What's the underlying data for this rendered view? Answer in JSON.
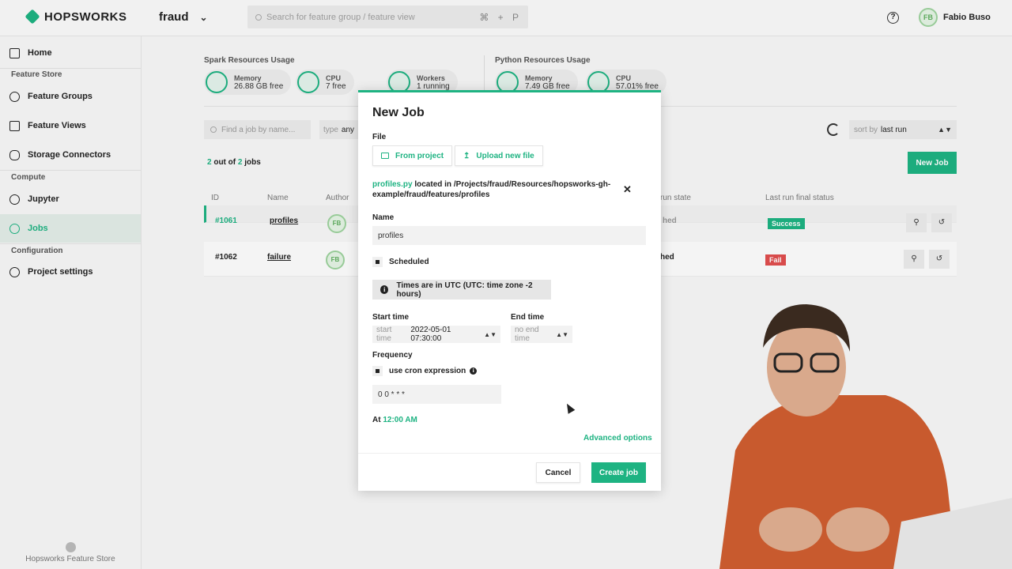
{
  "app": {
    "brand": "HOPSWORKS",
    "project": "fraud",
    "user": "Fabio Buso",
    "user_initials": "FB",
    "accent": "#1eb382"
  },
  "search": {
    "placeholder": "Search for feature group / feature view",
    "shortcut": "⌘ + P"
  },
  "sidebar": {
    "home": "Home",
    "feature_store_section": "Feature Store",
    "feature_groups": "Feature Groups",
    "feature_views": "Feature Views",
    "storage_connectors": "Storage Connectors",
    "compute_section": "Compute",
    "jupyter": "Jupyter",
    "jobs": "Jobs",
    "configuration_section": "Configuration",
    "project_settings": "Project settings",
    "footer": "Hopsworks Feature Store"
  },
  "resources": {
    "spark_label": "Spark Resources Usage",
    "python_label": "Python Resources Usage",
    "spark": [
      {
        "title": "Memory",
        "value": "26.88 GB free"
      },
      {
        "title": "CPU",
        "value": "7 free"
      },
      {
        "title": "Workers",
        "value": "1 running"
      }
    ],
    "python": [
      {
        "title": "Memory",
        "value": "7.49 GB free"
      },
      {
        "title": "CPU",
        "value": "57.01% free"
      }
    ]
  },
  "jobs": {
    "search_placeholder": "Find a job by name...",
    "type_label": "type",
    "type_value": "any",
    "sort_label": "sort by",
    "sort_value": "last run",
    "count_shown": "2",
    "count_text_1": "out of",
    "count_total": "2",
    "count_text_2": "jobs",
    "new_job": "New Job",
    "headers": {
      "id": "ID",
      "name": "Name",
      "author": "Author",
      "run_state": "run state",
      "final_status": "Last run final status"
    },
    "rows": [
      {
        "id": "#1061",
        "name": "profiles",
        "author": "FB",
        "state": "hed",
        "status": "Success"
      },
      {
        "id": "#1062",
        "name": "failure",
        "author": "FB",
        "state": "hed",
        "status": "Fail"
      }
    ]
  },
  "modal": {
    "title": "New Job",
    "file_label": "File",
    "from_project": "From project",
    "upload": "Upload new file",
    "file_name": "profiles.py",
    "file_located": "located in /Projects/fraud/Resources/hopsworks-gh-example/fraud/features/profiles",
    "name_label": "Name",
    "name_value": "profiles",
    "scheduled": "Scheduled",
    "utc_note": "Times are in UTC (UTC: time zone -2 hours)",
    "start_label": "Start time",
    "start_prefix": "start time",
    "start_value": "2022-05-01 07:30:00",
    "end_label": "End time",
    "end_value": "no end time",
    "frequency_label": "Frequency",
    "cron_label": "use cron expression",
    "cron_value": "0 0 * * *",
    "at_label": "At",
    "at_value": "12:00 AM",
    "advanced": "Advanced options",
    "cancel": "Cancel",
    "create": "Create job"
  }
}
